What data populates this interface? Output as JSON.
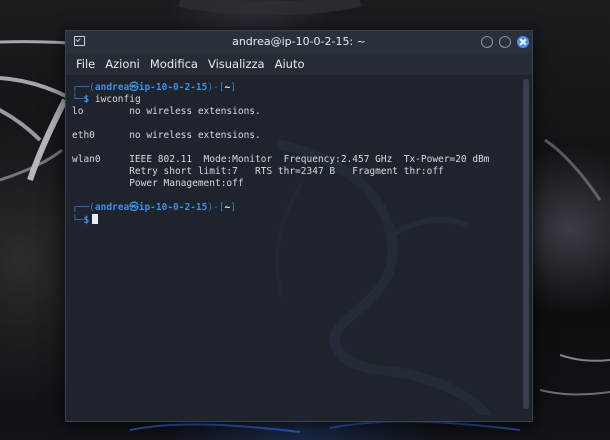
{
  "window": {
    "title": "andrea@ip-10-0-2-15: ~"
  },
  "menu": {
    "items": [
      "File",
      "Azioni",
      "Modifica",
      "Visualizza",
      "Aiuto"
    ]
  },
  "prompt1": {
    "open": "┌──(",
    "user": "andrea",
    "at": "㉿",
    "host": "ip-10-0-2-15",
    "mid": ")-[",
    "path": "~",
    "close": "]",
    "branch": "└─",
    "dollar": "$",
    "command": "iwconfig"
  },
  "output": [
    "lo        no wireless extensions.",
    "",
    "eth0      no wireless extensions.",
    "",
    "wlan0     IEEE 802.11  Mode:Monitor  Frequency:2.457 GHz  Tx-Power=20 dBm",
    "          Retry short limit:7   RTS thr=2347 B   Fragment thr:off",
    "          Power Management:off"
  ],
  "prompt2": {
    "open": "┌──(",
    "user": "andrea",
    "at": "㉿",
    "host": "ip-10-0-2-15",
    "mid": ")-[",
    "path": "~",
    "close": "]",
    "branch": "└─",
    "dollar": "$"
  },
  "colors": {
    "accent": "#3f8fe8",
    "terminal_bg": "#1e232c",
    "close_button": "#4e8ef7"
  }
}
